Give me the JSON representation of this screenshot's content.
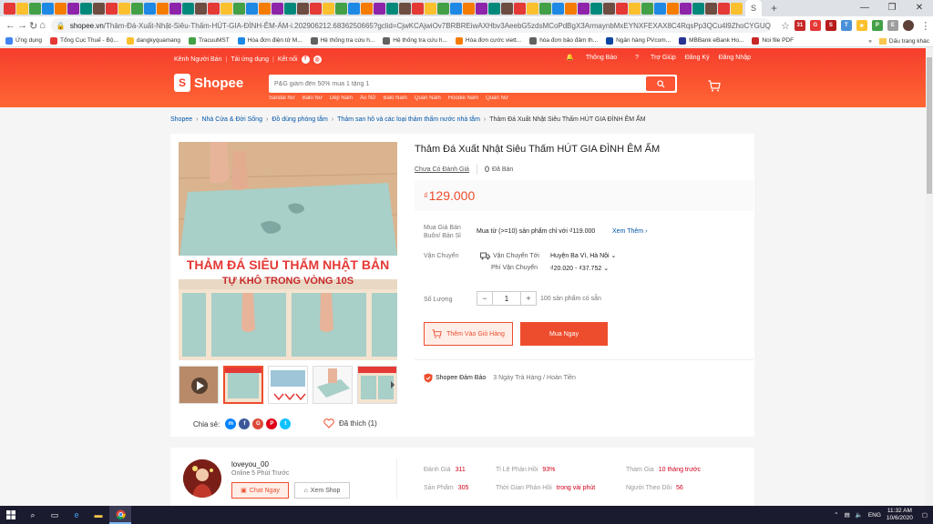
{
  "browser": {
    "tab_count_visible": 58,
    "url_host": "shopee.vn",
    "url_path": "/Thảm-Đá-Xuất-Nhật-Siêu-Thấm-HÚT-GIA-ĐÌNH-ÊM-ÁM-i.202906212.6836250665?gclid=CjwKCAjwiOv7BRBREiwAXHbv3AeebG5zdsMCoPdBgX3ArmaynbMxEYNXFEXAX8C4RqsPp3QCu4l9ZhoCYGUQAvD_BwE",
    "window_controls": [
      "—",
      "❐",
      "✕"
    ],
    "bookmarks": [
      "Ứng dụng",
      "Tổng Cục Thuế - Bộ...",
      "dangkyquamang",
      "TracuuMST",
      "Hóa đơn điện tử M...",
      "Hệ thống tra cứu h...",
      "Hệ thống tra cứu h...",
      "Hóa đơn cước viett...",
      "hóa đơn bảo đảm th...",
      "Ngân hàng PVcom...",
      "MBBank eBank Ho...",
      "Noi file PDF"
    ],
    "bookmarks_right": "Dấu trang khác",
    "bookmarks_more": "»"
  },
  "header": {
    "seller_channel": "Kênh Người Bán",
    "download_app": "Tải ứng dụng",
    "connect": "Kết nối",
    "notifications": "Thông Báo",
    "help": "Trợ Giúp",
    "register": "Đăng Ký",
    "login": "Đăng Nhập",
    "logo_text": "Shopee",
    "search_placeholder": "P&G giảm đến 50% mua 1 tặng 1",
    "hot_words": [
      "Sandal Nữ",
      "Balo Nữ",
      "Dép Nam",
      "Áo Nữ",
      "Balo Nam",
      "Quần Nam",
      "Hoodie Nam",
      "Quần Nữ"
    ]
  },
  "breadcrumb": [
    "Shopee",
    "Nhà Cửa & Đời Sống",
    "Đồ dùng phòng tắm",
    "Thảm san hô và các loại thảm thấm nước nhà tắm",
    "Thảm Đá Xuất Nhật Siêu Thấm HÚT GIA ĐÌNH ÊM ẤM"
  ],
  "product": {
    "title": "Thảm Đá Xuất Nhật Siêu Thấm HÚT GIA ĐÌNH ÊM ẤM",
    "rating_text": "Chưa Có Đánh Giá",
    "sold_count": "0",
    "sold_label": "Đã Bán",
    "price_currency": "₫",
    "price": "129.000",
    "image_banner_line1": "THẢM ĐÁ SIÊU THẤM NHẬT BẢN",
    "image_banner_line2": "TỰ KHÔ TRONG VÒNG 10S",
    "wholesale_label_1": "Mua Giá Bán",
    "wholesale_label_2": "Buôn/ Bán Sỉ",
    "wholesale_text": "Mua từ (>=10) sản phẩm chỉ với ₫119.000",
    "see_more": "Xem Thêm",
    "shipping_label": "Vận Chuyển",
    "ship_to_label": "Vận Chuyển Tới",
    "ship_to_value": "Huyện Ba Vì, Hà Nội",
    "ship_fee_label": "Phí Vận Chuyển",
    "ship_fee_value": "₫20.020 - ₫37.752",
    "quantity_label": "Số Lượng",
    "quantity_minus": "−",
    "quantity": "1",
    "quantity_plus": "+",
    "stock_text": "100 sản phẩm có sẵn",
    "add_to_cart": "Thêm Vào Giỏ Hàng",
    "buy_now": "Mua Ngay",
    "guarantee_title": "Shopee Đảm Bảo",
    "guarantee_sub": "3 Ngày Trả Hàng / Hoàn Tiền",
    "share_label": "Chia sẻ:",
    "like_label": "Đã thích (1)"
  },
  "shop": {
    "name": "loveyou_00",
    "online": "Online 5 Phút Trước",
    "chat_button": "Chat Ngay",
    "view_shop": "Xem Shop",
    "stats": [
      {
        "label": "Đánh Giá",
        "value": "311"
      },
      {
        "label": "Sản Phẩm",
        "value": "305"
      },
      {
        "label": "Tỉ Lệ Phản Hồi",
        "value": "93%"
      },
      {
        "label": "Thời Gian Phản Hồi",
        "value": "trong vài phút"
      },
      {
        "label": "Tham Gia",
        "value": "10 tháng trước"
      },
      {
        "label": "Người Theo Dõi",
        "value": "56"
      }
    ]
  },
  "taskbar": {
    "lang": "ENG",
    "time": "11:32 AM",
    "date": "10/6/2020"
  },
  "colors": {
    "brand": "#ee4d2d",
    "link": "#0055aa"
  }
}
